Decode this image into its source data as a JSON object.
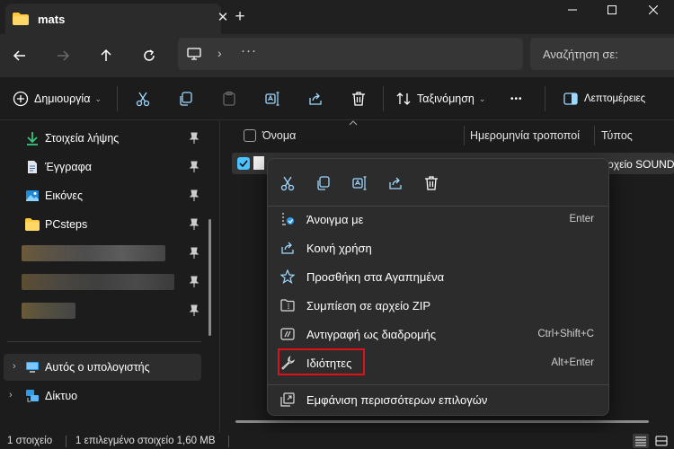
{
  "tab": {
    "title": "mats",
    "close": "✕"
  },
  "new_tab": "+",
  "window_controls": {
    "minimize": "—",
    "maximize": "☐",
    "close": "✕"
  },
  "address": {
    "chevron": "›",
    "ellipsis": "···"
  },
  "search": {
    "placeholder": "Αναζήτηση σε:"
  },
  "commandbar": {
    "new_label": "Δημιουργία",
    "sort_label": "Ταξινόμηση",
    "more": "•••",
    "details_label": "Λεπτομέρειες"
  },
  "sidebar": {
    "items": [
      {
        "label": "Στοιχεία λήψης",
        "icon": "download-icon"
      },
      {
        "label": "Έγγραφα",
        "icon": "document-icon"
      },
      {
        "label": "Εικόνες",
        "icon": "pictures-icon"
      },
      {
        "label": "PCsteps",
        "icon": "folder-icon"
      }
    ],
    "this_pc": "Αυτός ο υπολογιστής",
    "network": "Δίκτυο"
  },
  "filelist": {
    "columns": [
      "Όνομα",
      "Ημερομηνία τροποποί",
      "Τύπος"
    ],
    "rows": [
      {
        "type": "Αρχείο SOUNDR"
      }
    ]
  },
  "context_menu": {
    "quick_actions": [
      "cut-icon",
      "copy-icon",
      "rename-icon",
      "share-icon",
      "delete-icon"
    ],
    "items": [
      {
        "label": "Άνοιγμα με",
        "shortcut": "Enter",
        "icon": "open-with-icon"
      },
      {
        "label": "Κοινή χρήση",
        "shortcut": "",
        "icon": "share-icon"
      },
      {
        "label": "Προσθήκη στα Αγαπημένα",
        "shortcut": "",
        "icon": "star-icon"
      },
      {
        "label": "Συμπίεση σε αρχείο ZIP",
        "shortcut": "",
        "icon": "zip-icon"
      },
      {
        "label": "Αντιγραφή ως διαδρομής",
        "shortcut": "Ctrl+Shift+C",
        "icon": "copy-path-icon"
      },
      {
        "label": "Ιδιότητες",
        "shortcut": "Alt+Enter",
        "icon": "wrench-icon"
      }
    ],
    "more_options": "Εμφάνιση περισσότερων επιλογών"
  },
  "status": {
    "count": "1 στοιχείο",
    "selected": "1 επιλεγμένο στοιχείο 1,60 MB"
  },
  "colors": {
    "accent": "#4cc2ff",
    "highlight_box": "#e0101a",
    "folder": "#ffc83d"
  }
}
